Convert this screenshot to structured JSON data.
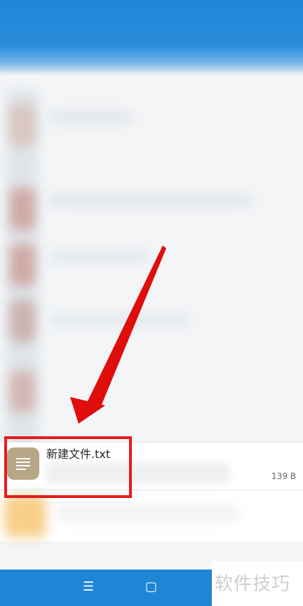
{
  "file": {
    "name": "新建文件.txt",
    "size": "139 B"
  },
  "navbar": {
    "menu_icon": "☰",
    "home_icon": "▢"
  },
  "watermark": "软件技巧",
  "colors": {
    "header_blue": "#1f86d6",
    "highlight_red": "#e41b1b",
    "file_icon_bg": "#b6a887"
  },
  "icons": {
    "file": "text-file-icon",
    "menu": "menu-icon",
    "home": "home-square-icon",
    "annotation": "red-arrow-icon"
  }
}
